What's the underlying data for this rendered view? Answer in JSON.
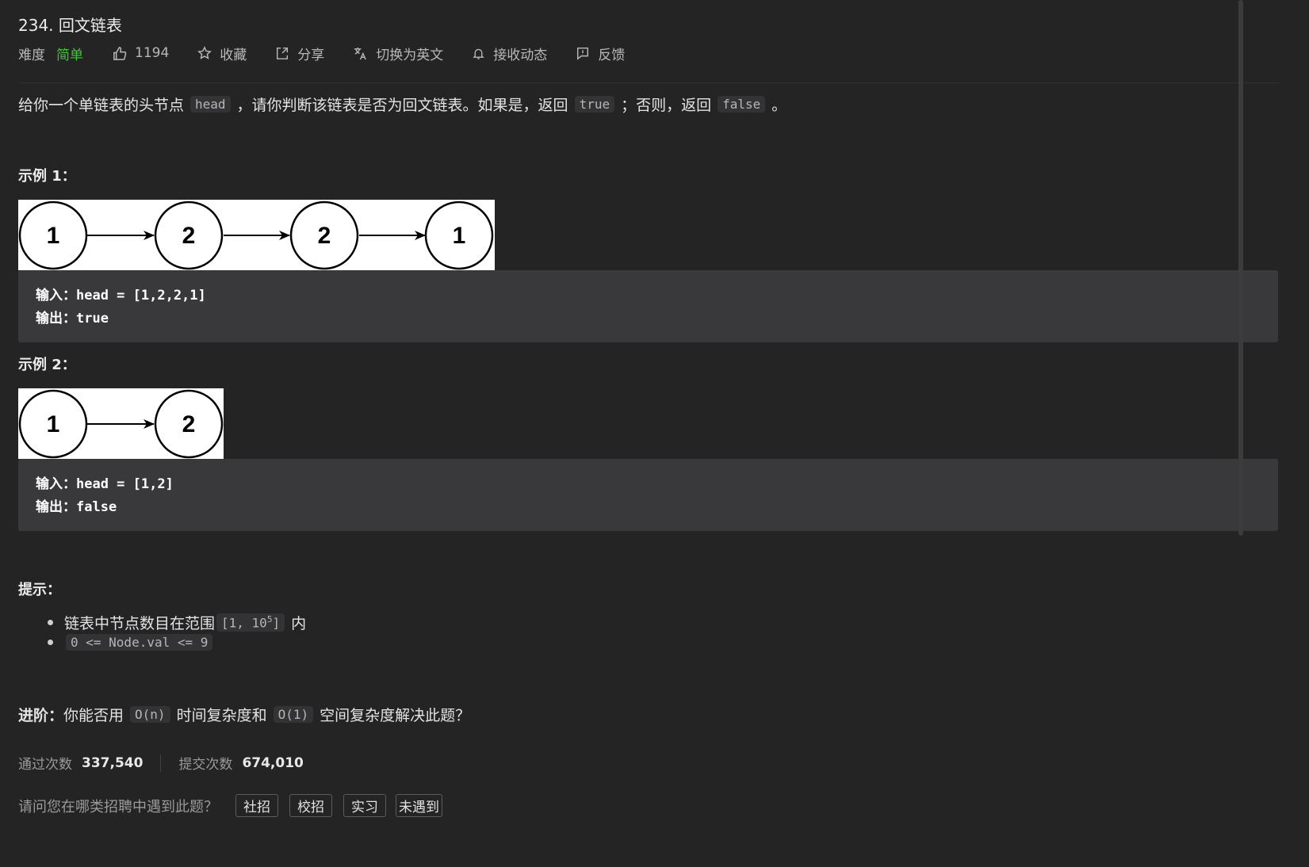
{
  "problem": {
    "title": "234. 回文链表",
    "difficulty_label": "难度",
    "difficulty_value": "简单",
    "likes": "1194",
    "favorite_label": "收藏",
    "share_label": "分享",
    "switch_lang_label": "切换为英文",
    "subscribe_label": "接收动态",
    "feedback_label": "反馈"
  },
  "description": {
    "p1": "给你一个单链表的头节点",
    "code1": "head",
    "p2": "，请你判断该链表是否为回文链表。如果是，返回",
    "code2": "true",
    "p3": "；否则，返回",
    "code3": "false",
    "p4": "。"
  },
  "examples": [
    {
      "heading": "示例 1：",
      "nodes": [
        "1",
        "2",
        "2",
        "1"
      ],
      "input_label": "输入：",
      "input_value": "head = [1,2,2,1]",
      "output_label": "输出：",
      "output_value": "true"
    },
    {
      "heading": "示例 2：",
      "nodes": [
        "1",
        "2"
      ],
      "input_label": "输入：",
      "input_value": "head = [1,2]",
      "output_label": "输出：",
      "output_value": "false"
    }
  ],
  "hints": {
    "heading": "提示：",
    "item1_text": "链表中节点数目在范围",
    "item1_code": "[1, 10",
    "item1_sup": "5",
    "item1_close": "]",
    "item1_suffix": "内",
    "item2_code": "0 <= Node.val <= 9"
  },
  "advanced": {
    "label": "进阶：",
    "t1": "你能否用",
    "c1": "O(n)",
    "t2": "时间复杂度和",
    "c2": "O(1)",
    "t3": "空间复杂度解决此题？"
  },
  "stats": {
    "accepted_label": "通过次数",
    "accepted_value": "337,540",
    "submitted_label": "提交次数",
    "submitted_value": "674,010"
  },
  "interview": {
    "question": "请问您在哪类招聘中遇到此题？",
    "tags": [
      "社招",
      "校招",
      "实习",
      "未遇到"
    ]
  },
  "icons": [
    "thumbs-up-icon",
    "star-icon",
    "share-icon",
    "translate-icon",
    "bell-icon",
    "feedback-icon"
  ]
}
